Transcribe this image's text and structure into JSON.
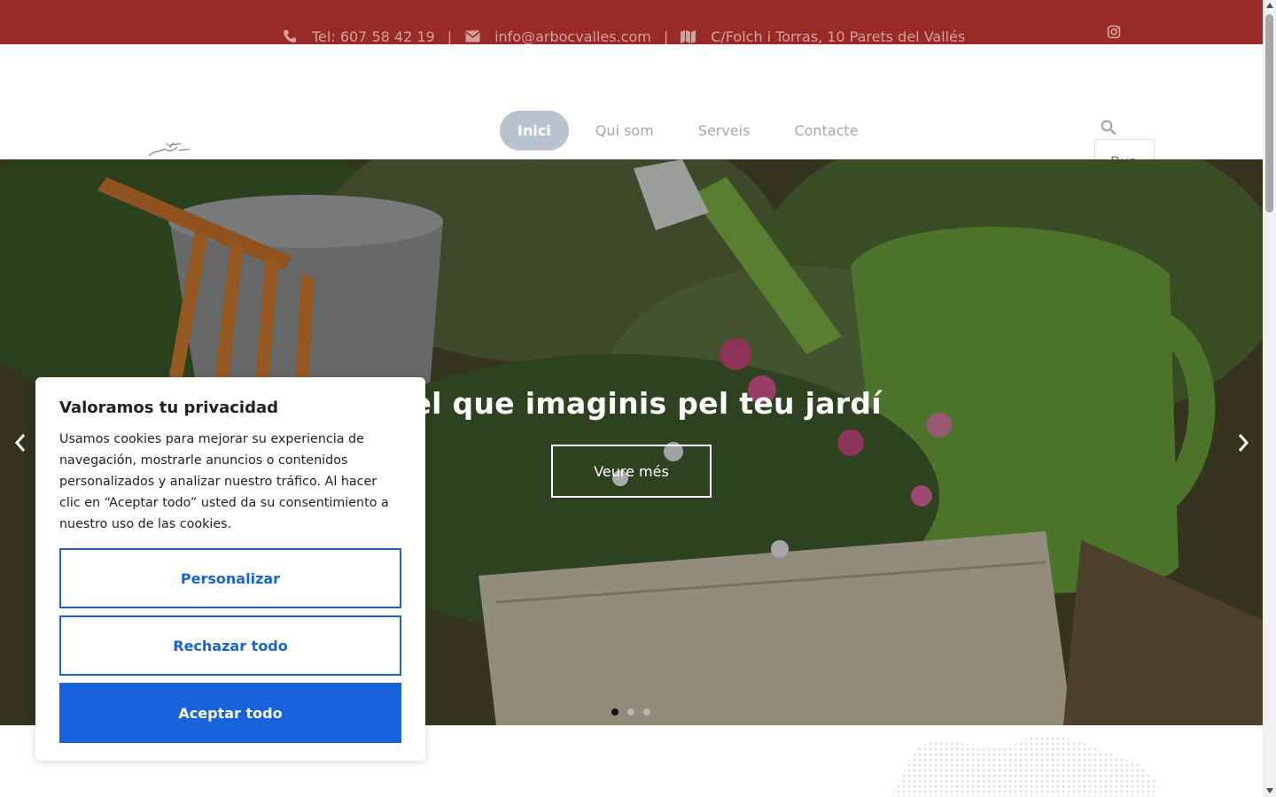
{
  "topbar": {
    "phone": "Tel: 607 58 42 19",
    "email": "info@arbocvalles.com",
    "address": "C/Folch i Torras, 10 Parets del Vallés",
    "separator": "|",
    "icons": {
      "phone": "phone-icon",
      "email": "envelope-icon",
      "address": "map-icon",
      "social": "instagram-icon"
    },
    "background_color": "#9a2a26"
  },
  "nav": {
    "items": [
      {
        "label": "Inici",
        "active": true
      },
      {
        "label": "Qui som",
        "active": false
      },
      {
        "label": "Serveis",
        "active": false
      },
      {
        "label": "Contacte",
        "active": false
      }
    ],
    "active_color": "#b8c3cf"
  },
  "search": {
    "placeholder": "Bus"
  },
  "hero": {
    "title": "a el que imaginis pel teu jardí",
    "button_label": "Veure més",
    "slides_total": 3,
    "active_slide": 1
  },
  "cookie": {
    "title": "Valoramos tu privacidad",
    "text": "Usamos cookies para mejorar su experiencia de navegación, mostrarle anuncios o contenidos personalizados y analizar nuestro tráfico. Al hacer clic en “Aceptar todo” usted da su consentimiento a nuestro uso de las cookies.",
    "customize_label": "Personalizar",
    "reject_label": "Rechazar todo",
    "accept_label": "Aceptar todo",
    "accent_color": "#1863dc"
  }
}
